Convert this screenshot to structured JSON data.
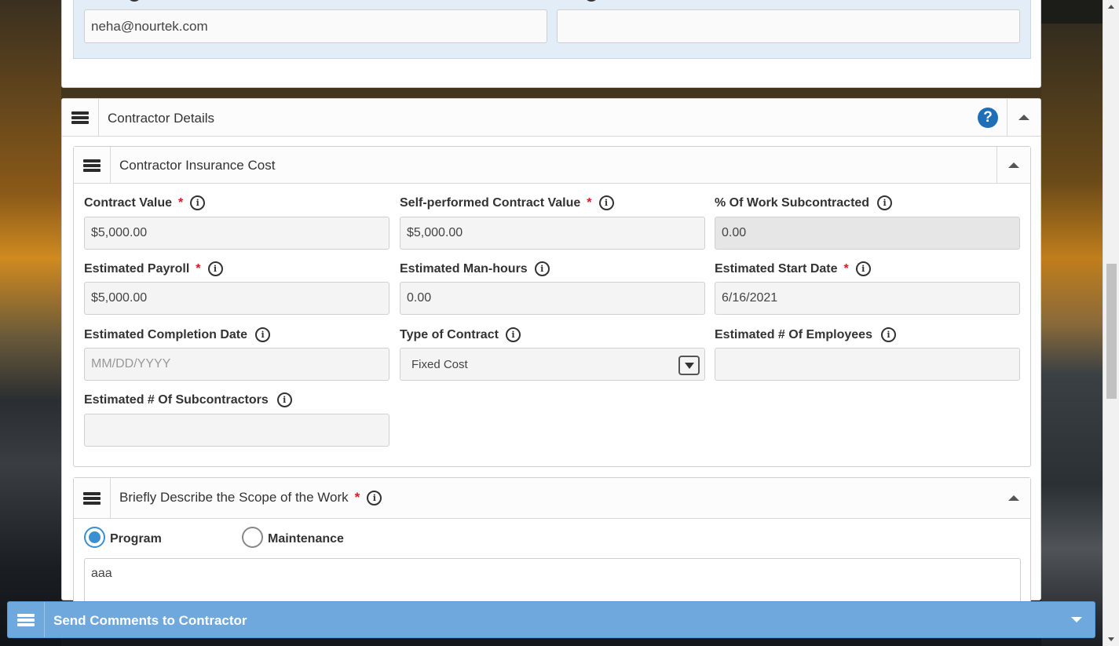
{
  "top_section": {
    "email_value": "neha@nourtek.com",
    "second_value": ""
  },
  "contractor_details": {
    "title": "Contractor Details",
    "help_icon": "?",
    "insurance_cost": {
      "title": "Contractor Insurance Cost",
      "fields": {
        "contract_value": {
          "label": "Contract Value",
          "value": "$5,000.00"
        },
        "self_performed": {
          "label": "Self-performed Contract Value",
          "value": "$5,000.00"
        },
        "pct_subcontracted": {
          "label": "% Of Work Subcontracted",
          "value": "0.00"
        },
        "est_payroll": {
          "label": "Estimated Payroll",
          "value": "$5,000.00"
        },
        "est_manhours": {
          "label": "Estimated Man-hours",
          "value": "0.00"
        },
        "est_start": {
          "label": "Estimated Start Date",
          "value": "6/16/2021"
        },
        "est_completion": {
          "label": "Estimated Completion Date",
          "placeholder": "MM/DD/YYYY"
        },
        "contract_type": {
          "label": "Type of Contract",
          "value": "Fixed Cost"
        },
        "est_employees": {
          "label": "Estimated # Of Employees",
          "value": ""
        },
        "est_subcontractors": {
          "label": "Estimated # Of Subcontractors",
          "value": ""
        }
      }
    },
    "scope": {
      "title": "Briefly Describe the Scope of the Work",
      "options": [
        "Program",
        "Maintenance"
      ],
      "selected": "Program",
      "text": "aaa"
    }
  },
  "footer": {
    "title": "Send Comments to Contractor"
  },
  "icons": {
    "info": "info-icon",
    "menu": "hamburger-menu-icon",
    "help": "help-icon",
    "collapse": "chevron-up-icon",
    "expand": "chevron-down-icon"
  },
  "colors": {
    "accent_blue": "#1f6fb8",
    "footer_bar": "#6fa8dc",
    "required_red": "#d21e1e",
    "radio_blue": "#3a8fd0"
  }
}
